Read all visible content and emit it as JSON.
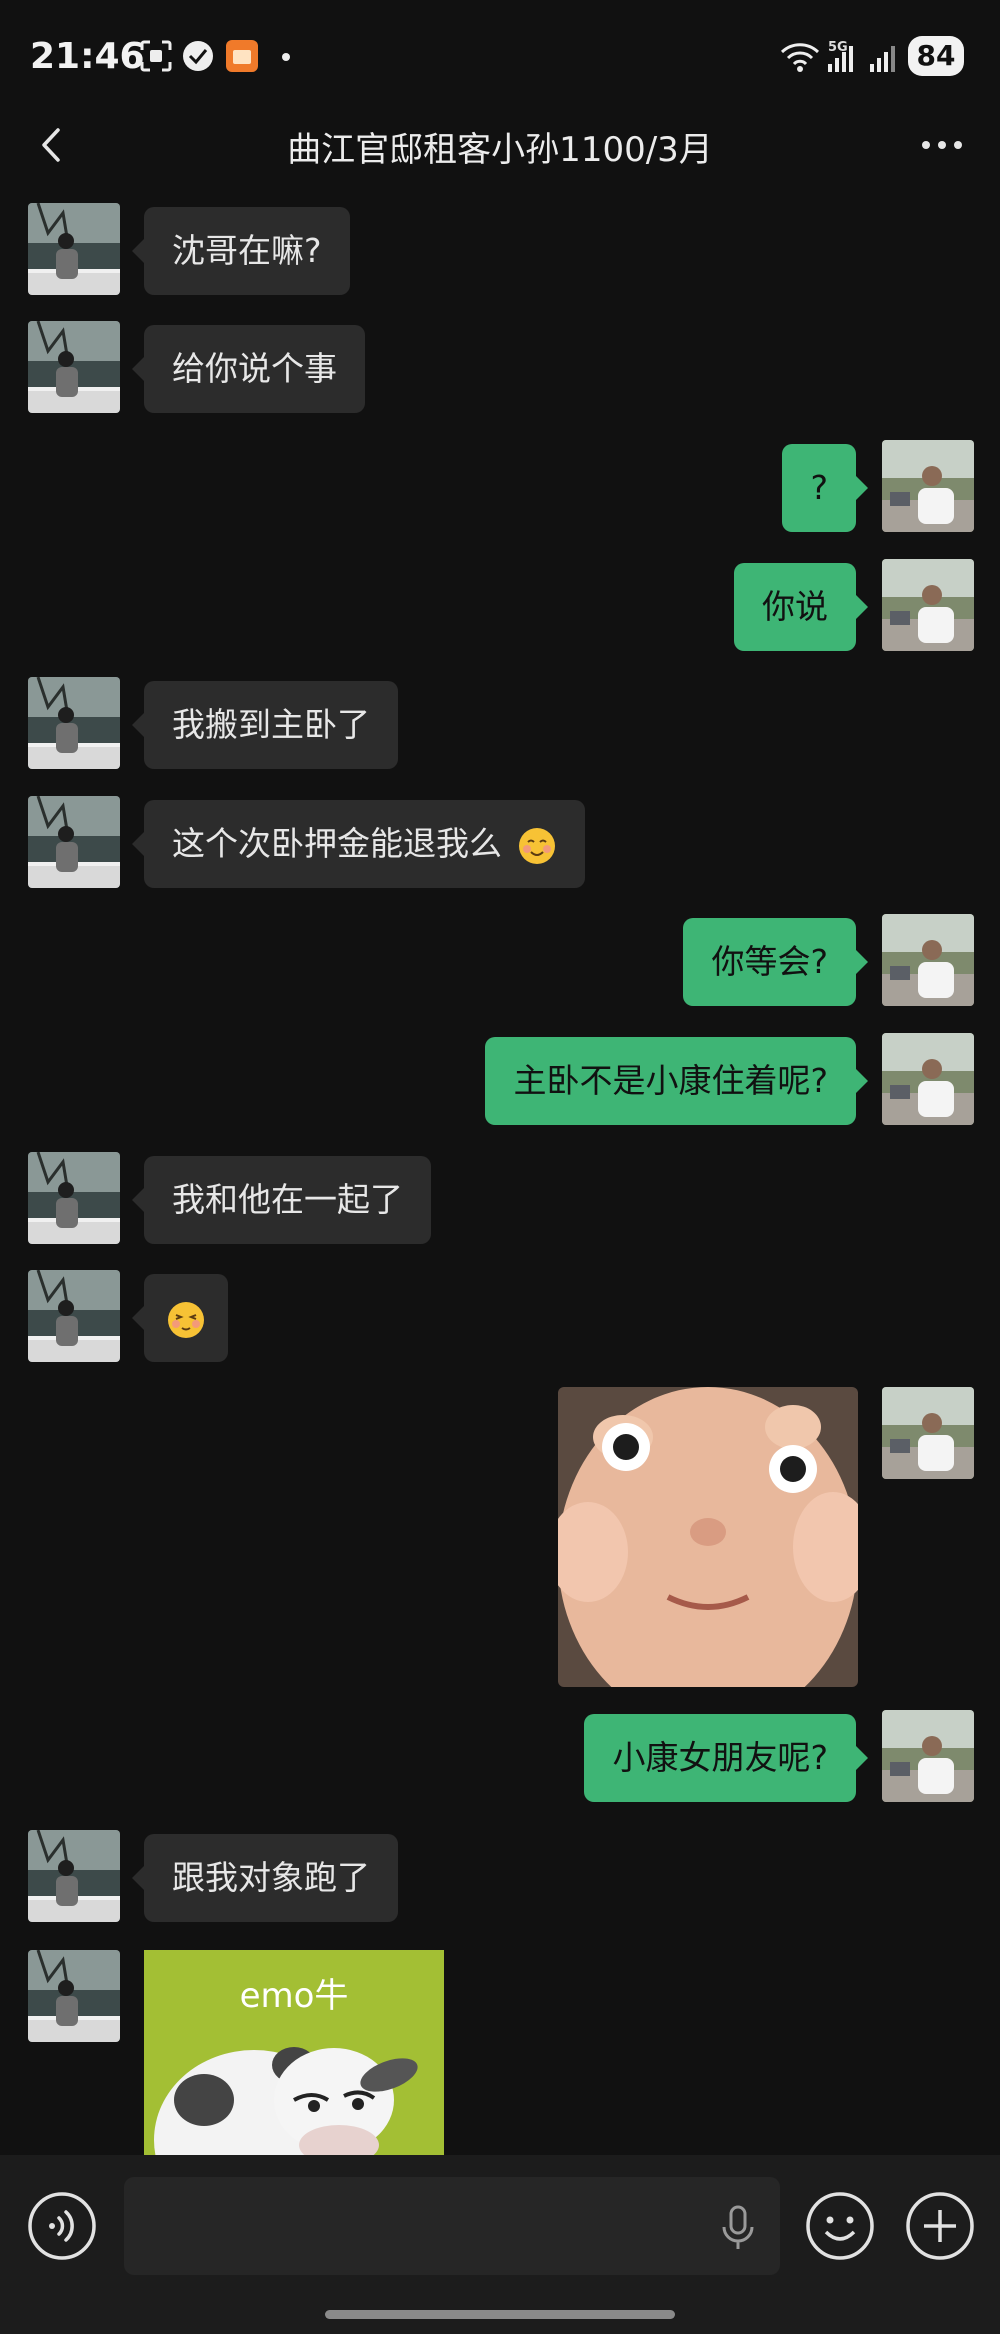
{
  "status_bar": {
    "time": "21:46",
    "network": "5G",
    "battery": "84",
    "icons": [
      "scan-icon",
      "check-badge-icon",
      "app-notification-icon",
      "dot-icon",
      "wifi-icon",
      "signal-icon"
    ]
  },
  "header": {
    "title": "曲江官邸租客小孙1100/3月",
    "back_icon": "back-icon",
    "more_icon": "more-icon"
  },
  "messages": [
    {
      "side": "left",
      "text": "沈哥在嘛?"
    },
    {
      "side": "left",
      "text": "给你说个事"
    },
    {
      "side": "right",
      "text": "?"
    },
    {
      "side": "right",
      "text": "你说"
    },
    {
      "side": "left",
      "text": "我搬到主卧了"
    },
    {
      "side": "left",
      "text": "这个次卧押金能退我么",
      "emoji": "smiling-face-emoji"
    },
    {
      "side": "right",
      "text": "你等会?"
    },
    {
      "side": "right",
      "text": "主卧不是小康住着呢?"
    },
    {
      "side": "left",
      "text": "我和他在一起了"
    },
    {
      "side": "left",
      "emoji": "shy-face-emoji"
    },
    {
      "side": "right",
      "sticker": "baby-face-sticker"
    },
    {
      "side": "right",
      "text": "小康女朋友呢?"
    },
    {
      "side": "left",
      "text": "跟我对象跑了"
    },
    {
      "side": "left",
      "sticker": "emo-cow-sticker",
      "sticker_text": "emo牛"
    }
  ],
  "input_bar": {
    "placeholder": "",
    "icons": [
      "voice-icon",
      "mic-icon",
      "emoji-icon",
      "plus-icon"
    ]
  },
  "colors": {
    "background": "#111111",
    "incoming_bubble": "#2c2c2c",
    "outgoing_bubble": "#3eb575",
    "input_bar": "#1c1c1c"
  }
}
